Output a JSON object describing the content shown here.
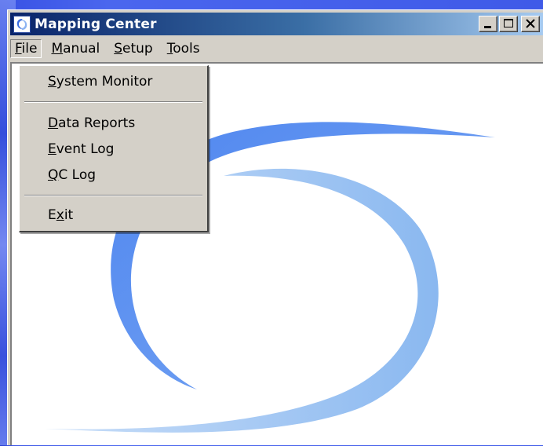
{
  "window": {
    "title": "Mapping Center",
    "controls": {
      "minimize": "minimize",
      "maximize": "maximize",
      "close": "close"
    }
  },
  "menubar": {
    "items": [
      {
        "label": "File",
        "mnemonic": "F",
        "rest": "ile",
        "active": true
      },
      {
        "label": "Manual",
        "mnemonic": "M",
        "rest": "anual"
      },
      {
        "label": "Setup",
        "mnemonic": "S",
        "rest": "etup"
      },
      {
        "label": "Tools",
        "mnemonic": "T",
        "rest": "ools"
      }
    ]
  },
  "file_menu": {
    "items": [
      {
        "label": "System Monitor",
        "pre": "",
        "mnemonic": "S",
        "rest": "ystem Monitor"
      },
      {
        "label": "Data Reports",
        "pre": "",
        "mnemonic": "D",
        "rest": "ata Reports"
      },
      {
        "label": "Event Log",
        "pre": "",
        "mnemonic": "E",
        "rest": "vent Log"
      },
      {
        "label": "QC Log",
        "pre": "",
        "mnemonic": "Q",
        "rest": "C Log"
      },
      {
        "label": "Exit",
        "pre": "E",
        "mnemonic": "x",
        "rest": "it"
      }
    ]
  },
  "colors": {
    "logo_dark_blue": "#5a8df0",
    "logo_light_blue": "#a9ccf5",
    "titlebar_start": "#0a246a",
    "titlebar_end": "#a6caf0"
  },
  "icons": {
    "app": "swirl-logo-icon",
    "minimize": "minimize-icon",
    "maximize": "maximize-icon",
    "close": "close-icon"
  }
}
